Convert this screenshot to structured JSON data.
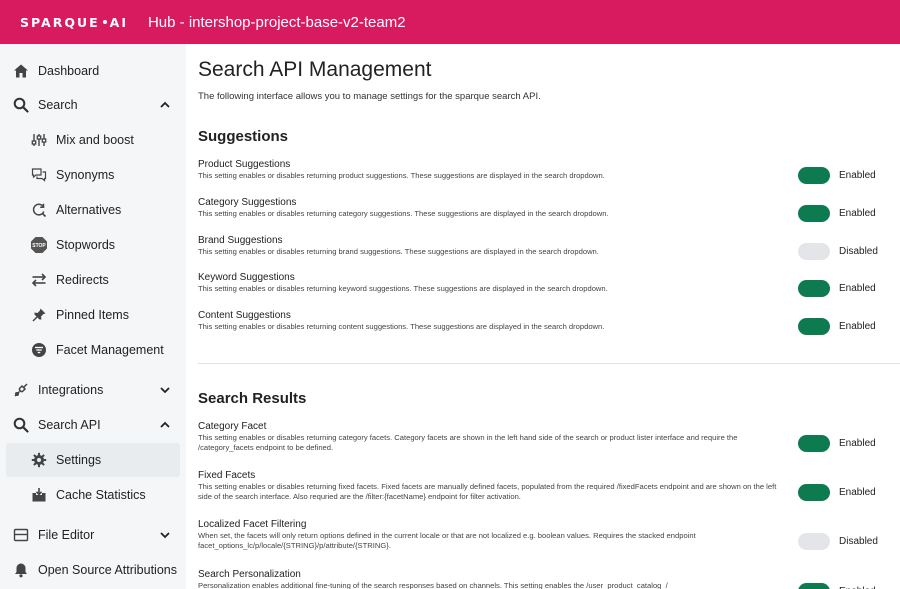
{
  "header": {
    "logo": "SPARQUE",
    "logo_suffix": "AI",
    "title": "Hub - intershop-project-base-v2-team2",
    "brand_color": "#d81b5f"
  },
  "sidebar": {
    "dashboard": "Dashboard",
    "search": "Search",
    "search_items": [
      "Mix and boost",
      "Synonyms",
      "Alternatives",
      "Stopwords",
      "Redirects",
      "Pinned Items",
      "Facet Management"
    ],
    "integrations": "Integrations",
    "search_api": "Search API",
    "search_api_items": [
      "Settings",
      "Cache Statistics"
    ],
    "file_editor": "File Editor",
    "open_source": "Open Source Attributions",
    "stop_icon_text": "STOP"
  },
  "main": {
    "title": "Search API Management",
    "description": "The following interface allows you to manage settings for the sparque search API.",
    "suggestions": {
      "title": "Suggestions",
      "items": [
        {
          "name": "Product Suggestions",
          "desc": "This setting enables or disables returning product suggestions. These suggestions are displayed in the search dropdown.",
          "state": "Enabled"
        },
        {
          "name": "Category Suggestions",
          "desc": "This setting enables or disables returning category suggestions. These suggestions are displayed in the search dropdown.",
          "state": "Enabled"
        },
        {
          "name": "Brand Suggestions",
          "desc": "This setting enables or disables returning brand suggestions. These suggestions are displayed in the search dropdown.",
          "state": "Disabled"
        },
        {
          "name": "Keyword Suggestions",
          "desc": "This setting enables or disables returning keyword suggestions. These suggestions are displayed in the search dropdown.",
          "state": "Enabled"
        },
        {
          "name": "Content Suggestions",
          "desc": "This setting enables or disables returning content suggestions. These suggestions are displayed in the search dropdown.",
          "state": "Enabled"
        }
      ]
    },
    "results": {
      "title": "Search Results",
      "items": [
        {
          "name": "Category Facet",
          "desc": "This setting enables or disables returning category facets. Category facets are shown in the left hand side of the search or product lister interface and require the /category_facets endpoint to be defined.",
          "state": "Enabled"
        },
        {
          "name": "Fixed Facets",
          "desc": "This setting enables or disables returning fixed facets. Fixed facets are manually defined facets, populated from the required /fixedFacets endpoint and are shown on the left side of the search interface. Also requried are the /filter:{facetName} endpoint for filter activation.",
          "state": "Enabled"
        },
        {
          "name": "Localized Facet Filtering",
          "desc": "When set, the facets will only return options defined in the current locale or that are not localized e.g. boolean values. Requires the stacked endpoint facet_options_lc/p/locale/{STRING}/p/attribute/{STRING}.",
          "state": "Disabled"
        },
        {
          "name": "Search Personalization",
          "desc": "Personalization enables additional fine-tuning of the search responses based on channels. This setting enables the /user_product_catalog_/",
          "state": "Enabled"
        }
      ]
    }
  }
}
